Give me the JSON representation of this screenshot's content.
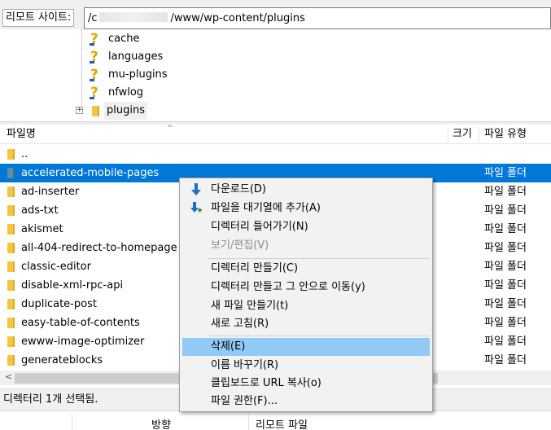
{
  "site": {
    "label": "리모트 사이트:",
    "path_prefix": "/c",
    "path_suffix": "/www/wp-content/plugins"
  },
  "tree": {
    "items": [
      {
        "label": "cache"
      },
      {
        "label": "languages"
      },
      {
        "label": "mu-plugins"
      },
      {
        "label": "nfwlog"
      },
      {
        "label": "plugins"
      }
    ]
  },
  "list": {
    "headers": {
      "name": "파일명",
      "size": "크기",
      "type": "파일 유형"
    },
    "rows": [
      {
        "name": "..",
        "type": ""
      },
      {
        "name": "accelerated-mobile-pages",
        "type": "파일 폴더"
      },
      {
        "name": "ad-inserter",
        "type": "파일 폴더"
      },
      {
        "name": "ads-txt",
        "type": "파일 폴더"
      },
      {
        "name": "akismet",
        "type": "파일 폴더"
      },
      {
        "name": "all-404-redirect-to-homepage",
        "type": "파일 폴더"
      },
      {
        "name": "classic-editor",
        "type": "파일 폴더"
      },
      {
        "name": "disable-xml-rpc-api",
        "type": "파일 폴더"
      },
      {
        "name": "duplicate-post",
        "type": "파일 폴더"
      },
      {
        "name": "easy-table-of-contents",
        "type": "파일 폴더"
      },
      {
        "name": "ewww-image-optimizer",
        "type": "파일 폴더"
      },
      {
        "name": "generateblocks",
        "type": "파일 폴더"
      }
    ]
  },
  "status": {
    "text": "디렉터리 1개 선택됨."
  },
  "bottom": {
    "direction": "방향",
    "remote_file": "리모트 파일"
  },
  "menu": {
    "download": "다운로드(D)",
    "add_queue": "파일을 대기열에 추가(A)",
    "enter_dir": "디렉터리 들어가기(N)",
    "view_edit": "보기/편집(V)",
    "mkdir": "디렉터리 만들기(C)",
    "mkdir_enter": "디렉터리 만들고 그 안으로 이동(y)",
    "new_file": "새 파일 만들기(t)",
    "refresh": "새로 고침(R)",
    "delete": "삭제(E)",
    "rename": "이름 바꾸기(R)",
    "copy_url": "클립보드로 URL 복사(o)",
    "permissions": "파일 권한(F)..."
  },
  "colors": {
    "selection": "#0078d7",
    "menu_highlight": "#91c9f7",
    "folder": "#f5c542"
  }
}
